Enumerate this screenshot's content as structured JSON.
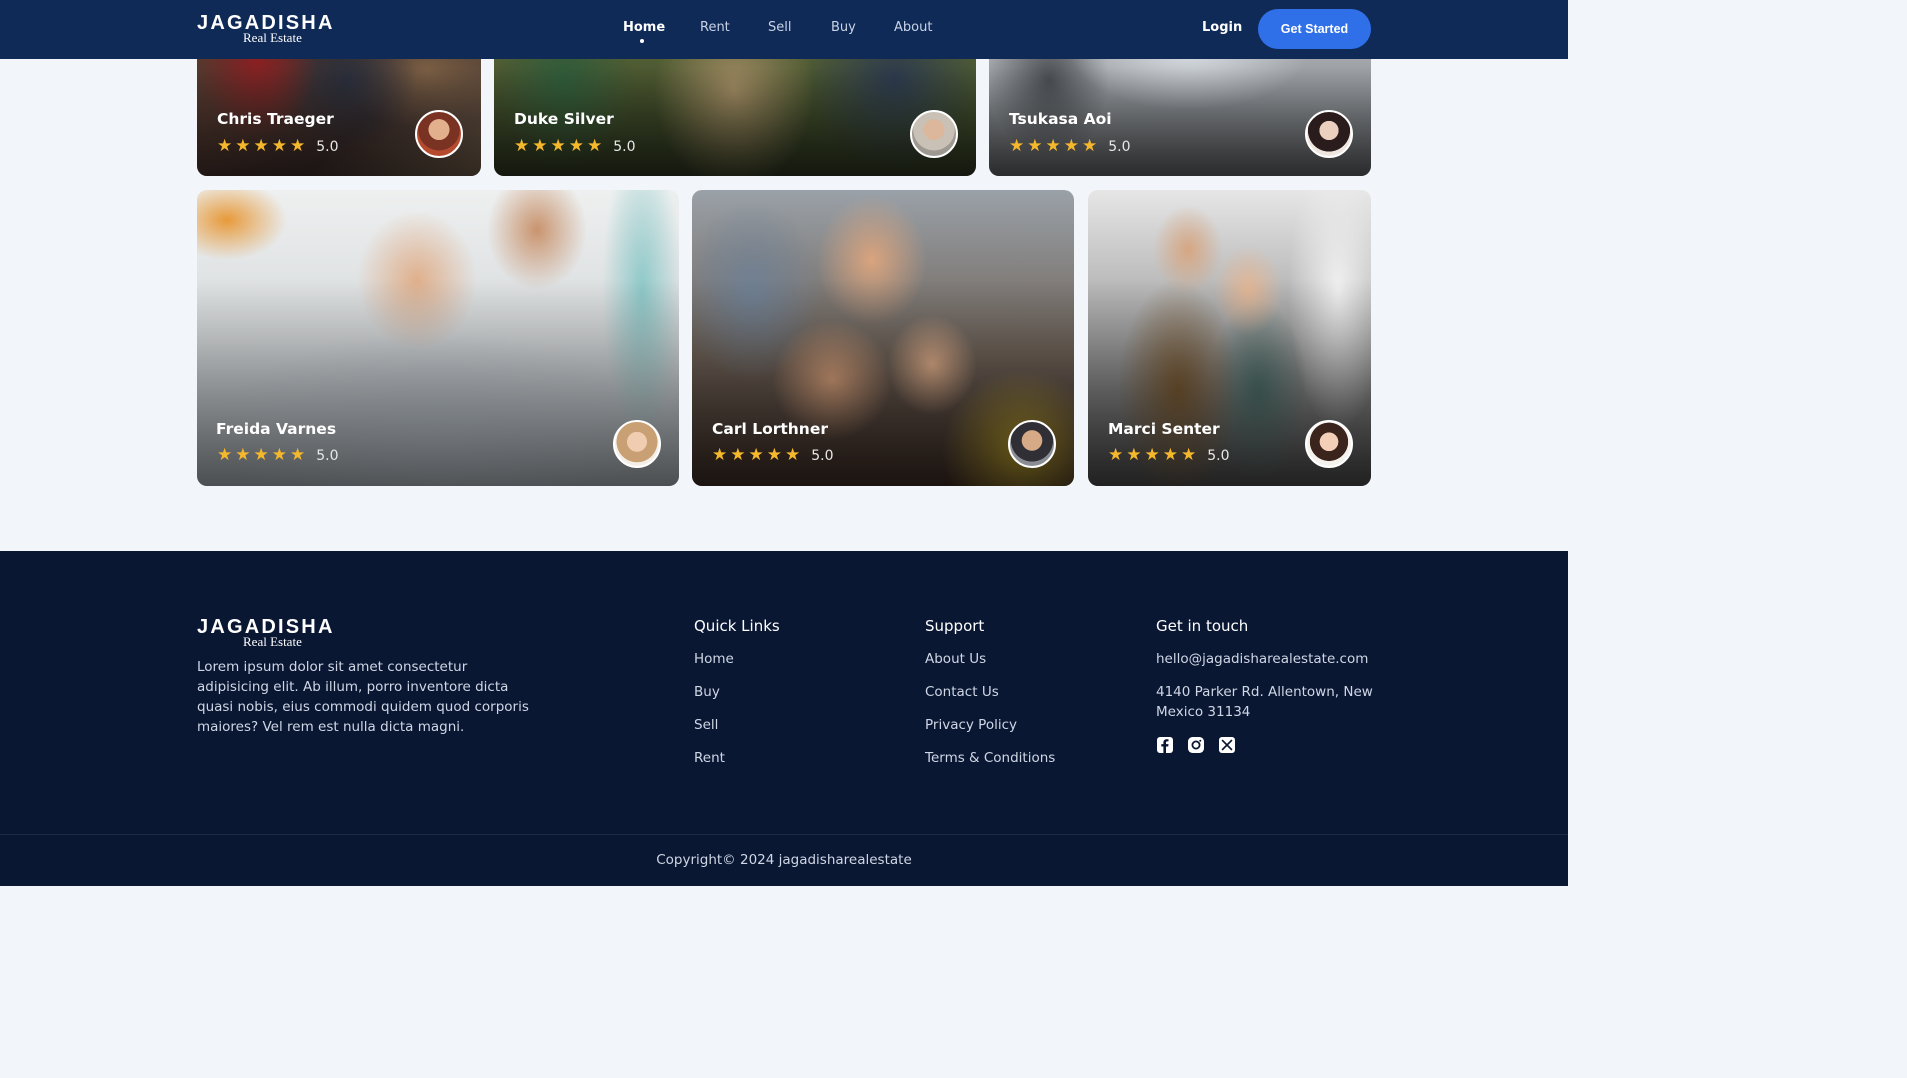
{
  "header": {
    "logo_brand": "JAGADISHA",
    "logo_sub": "Real Estate",
    "nav": [
      "Home",
      "Rent",
      "Sell",
      "Buy",
      "About"
    ],
    "active_nav": "Home",
    "login_label": "Login",
    "cta_label": "Get Started"
  },
  "testimonials": {
    "row1": [
      {
        "name": "Chris Traeger",
        "rating": "5.0"
      },
      {
        "name": "Duke Silver",
        "rating": "5.0"
      },
      {
        "name": "Tsukasa Aoi",
        "rating": "5.0"
      }
    ],
    "row2": [
      {
        "name": "Freida Varnes",
        "rating": "5.0"
      },
      {
        "name": "Carl Lorthner",
        "rating": "5.0"
      },
      {
        "name": "Marci Senter",
        "rating": "5.0"
      }
    ],
    "star_count": 5
  },
  "footer": {
    "logo_brand": "JAGADISHA",
    "logo_sub": "Real Estate",
    "about": "Lorem ipsum dolor sit amet consectetur adipisicing elit. Ab illum, porro inventore dicta quasi nobis, eius commodi quidem quod corporis maiores? Vel rem est nulla dicta magni.",
    "quick_links": {
      "title": "Quick Links",
      "items": [
        "Home",
        "Buy",
        "Sell",
        "Rent"
      ]
    },
    "support": {
      "title": "Support",
      "items": [
        "About Us",
        "Contact Us",
        "Privacy Policy",
        "Terms & Conditions"
      ]
    },
    "contact": {
      "title": "Get in touch",
      "email": "hello@jagadisharealestate.com",
      "address": "4140 Parker Rd. Allentown, New Mexico 31134",
      "socials": [
        "facebook-icon",
        "instagram-icon",
        "x-icon"
      ]
    },
    "copyright": "Copyright© 2024 jagadisharealestate"
  },
  "colors": {
    "header_bg": "#0f2a57",
    "footer_bg": "#0a1733",
    "cta_bg": "#2f6fe8",
    "page_bg": "#f2f5f9",
    "star": "#f5b72b"
  }
}
